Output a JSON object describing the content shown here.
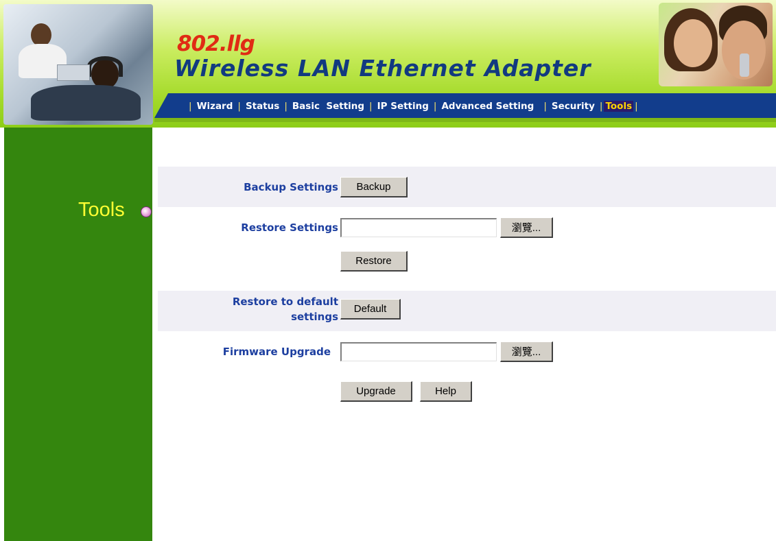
{
  "header": {
    "model": "802.llg",
    "product": "Wireless LAN Ethernet Adapter"
  },
  "nav": {
    "items": [
      {
        "label": "Wizard"
      },
      {
        "label": "Status"
      },
      {
        "label": "Basic  Setting"
      },
      {
        "label": "IP Setting"
      },
      {
        "label": "Advanced Setting"
      },
      {
        "label": "Security"
      },
      {
        "label": "Tools"
      }
    ],
    "active": "Tools"
  },
  "sidebar": {
    "label": "Tools"
  },
  "main": {
    "backup": {
      "label": "Backup Settings",
      "button": "Backup"
    },
    "restore": {
      "label": "Restore Settings",
      "file_value": "",
      "browse": "瀏覽...",
      "button": "Restore"
    },
    "default": {
      "label_line1": "Restore to default",
      "label_line2": "settings",
      "button": "Default"
    },
    "firmware": {
      "label": "Firmware Upgrade",
      "file_value": "",
      "browse": "瀏覽...",
      "button": "Upgrade",
      "help": "Help"
    }
  },
  "colors": {
    "nav_bg": "#123d8c",
    "sidebar_bg": "#34860e",
    "label_text": "#1d3fa0",
    "active_tab_text": "#ffd500",
    "sidebar_label": "#ffff33"
  }
}
